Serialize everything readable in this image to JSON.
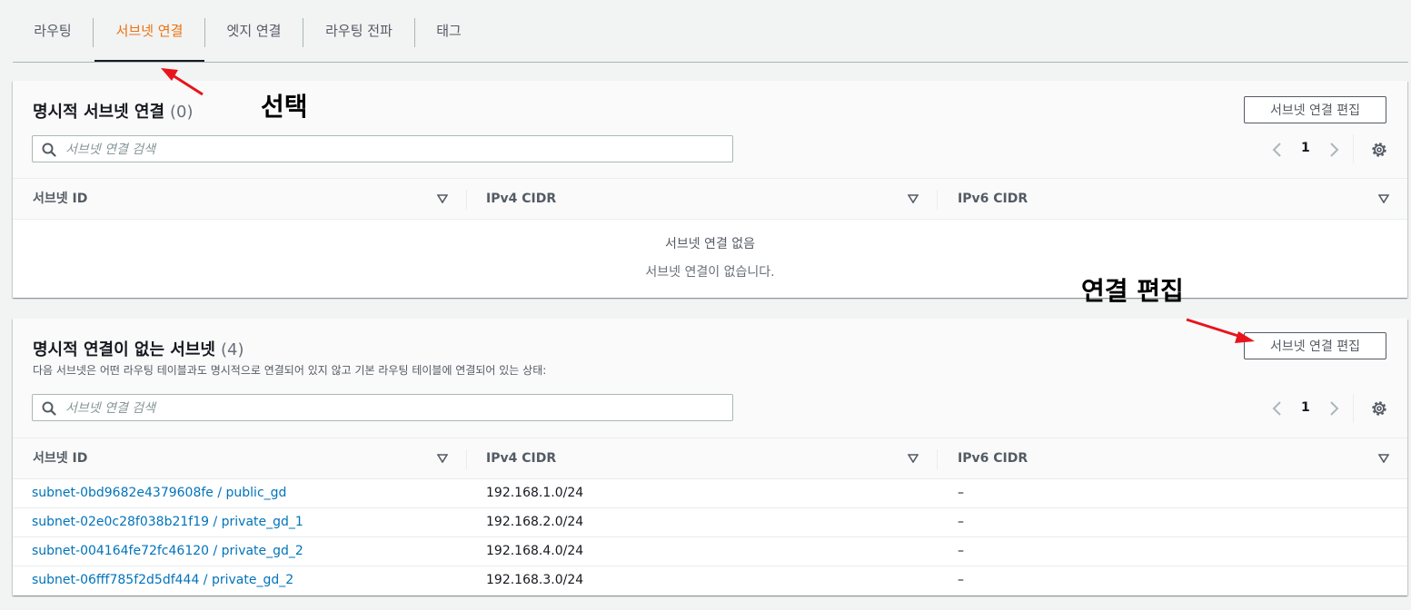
{
  "tabs": [
    {
      "label": "라우팅"
    },
    {
      "label": "서브넷 연결"
    },
    {
      "label": "엣지 연결"
    },
    {
      "label": "라우팅 전파"
    },
    {
      "label": "태그"
    }
  ],
  "panel1": {
    "title": "명시적 서브넷 연결",
    "count": "(0)",
    "button": "서브넷 연결 편집",
    "search_placeholder": "서브넷 연결 검색",
    "page": "1",
    "columns": [
      "서브넷 ID",
      "IPv4 CIDR",
      "IPv6 CIDR"
    ],
    "empty_title": "서브넷 연결 없음",
    "empty_desc": "서브넷 연결이 없습니다."
  },
  "panel2": {
    "title": "명시적 연결이 없는 서브넷",
    "count": "(4)",
    "description": "다음 서브넷은 어떤 라우팅 테이블과도 명시적으로 연결되어 있지 않고 기본 라우팅 테이블에 연결되어 있는 상태:",
    "button": "서브넷 연결 편집",
    "search_placeholder": "서브넷 연결 검색",
    "page": "1",
    "columns": [
      "서브넷 ID",
      "IPv4 CIDR",
      "IPv6 CIDR"
    ],
    "rows": [
      {
        "subnet": "subnet-0bd9682e4379608fe / public_gd",
        "ipv4": "192.168.1.0/24",
        "ipv6": "–"
      },
      {
        "subnet": "subnet-02e0c28f038b21f19 / private_gd_1",
        "ipv4": "192.168.2.0/24",
        "ipv6": "–"
      },
      {
        "subnet": "subnet-004164fe72fc46120 / private_gd_2",
        "ipv4": "192.168.4.0/24",
        "ipv6": "–"
      },
      {
        "subnet": "subnet-06fff785f2d5df444 / private_gd_2",
        "ipv4": "192.168.3.0/24",
        "ipv6": "–"
      }
    ]
  },
  "annotations": {
    "select": "선택",
    "edit": "연결 편집",
    "arrow_color": "#e8141c"
  },
  "colors": {
    "active_tab": "#ec7211",
    "link": "#0073bb"
  },
  "icons": {
    "search": "search-icon",
    "prev": "chevron-left-icon",
    "next": "chevron-right-icon",
    "settings": "gear-icon",
    "sort": "caret-down-icon"
  }
}
